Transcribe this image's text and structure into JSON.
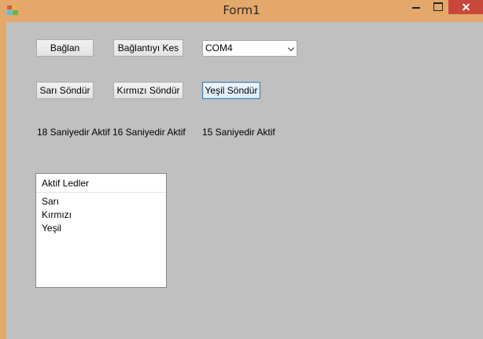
{
  "window": {
    "title": "Form1",
    "icon": "winforms-app-icon",
    "controls": {
      "minimize": "minimize-icon",
      "maximize": "maximize-icon",
      "close": "close-icon"
    }
  },
  "buttons": {
    "connect": "Bağlan",
    "disconnect": "Bağlantıyı Kes",
    "yellow_off": "Sarı Söndür",
    "red_off": "Kırmızı Söndür",
    "green_off": "Yeşil Söndür"
  },
  "port_select": {
    "selected": "COM4"
  },
  "labels": {
    "yellow_timer": "18 Saniyedir Aktif",
    "red_timer": "16 Saniyedir Aktif",
    "green_timer": "15 Saniyedir Aktif"
  },
  "active_leds": {
    "header": "Aktif Ledler",
    "items": [
      "Sarı",
      "Kırmızı",
      "Yeşil"
    ]
  },
  "colors": {
    "titlebar": "#e3a86a",
    "client_background": "#c0c0c0",
    "close_button": "#c7473a"
  }
}
